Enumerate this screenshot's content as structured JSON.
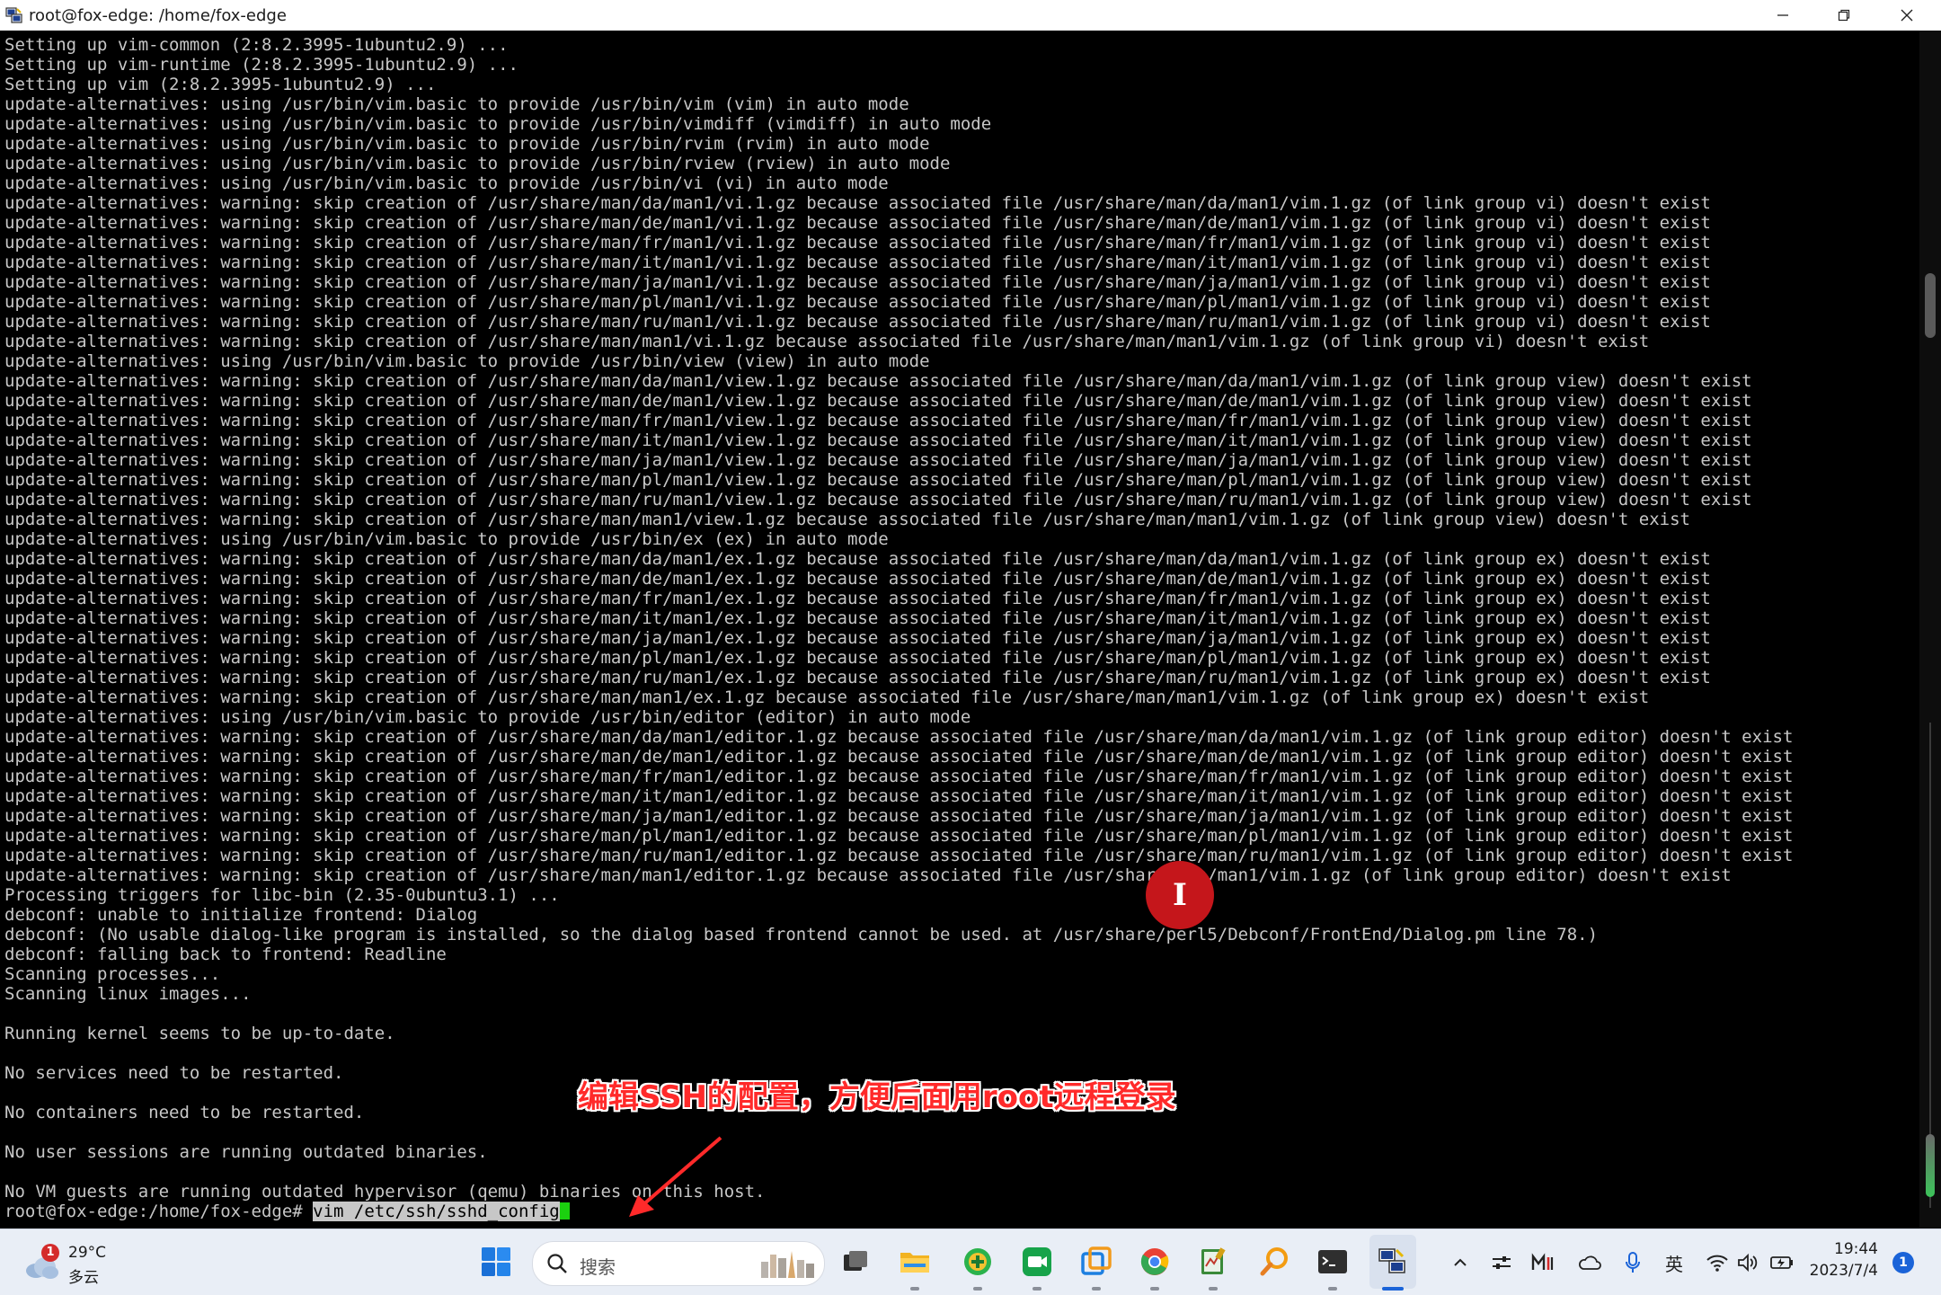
{
  "window": {
    "title": "root@fox-edge: /home/fox-edge",
    "controls": {
      "minimize": "minimize-icon",
      "maximize": "maximize-icon",
      "close": "close-icon"
    }
  },
  "terminal": {
    "lines": [
      "Setting up vim-common (2:8.2.3995-1ubuntu2.9) ...",
      "Setting up vim-runtime (2:8.2.3995-1ubuntu2.9) ...",
      "Setting up vim (2:8.2.3995-1ubuntu2.9) ...",
      "update-alternatives: using /usr/bin/vim.basic to provide /usr/bin/vim (vim) in auto mode",
      "update-alternatives: using /usr/bin/vim.basic to provide /usr/bin/vimdiff (vimdiff) in auto mode",
      "update-alternatives: using /usr/bin/vim.basic to provide /usr/bin/rvim (rvim) in auto mode",
      "update-alternatives: using /usr/bin/vim.basic to provide /usr/bin/rview (rview) in auto mode",
      "update-alternatives: using /usr/bin/vim.basic to provide /usr/bin/vi (vi) in auto mode",
      "update-alternatives: warning: skip creation of /usr/share/man/da/man1/vi.1.gz because associated file /usr/share/man/da/man1/vim.1.gz (of link group vi) doesn't exist",
      "update-alternatives: warning: skip creation of /usr/share/man/de/man1/vi.1.gz because associated file /usr/share/man/de/man1/vim.1.gz (of link group vi) doesn't exist",
      "update-alternatives: warning: skip creation of /usr/share/man/fr/man1/vi.1.gz because associated file /usr/share/man/fr/man1/vim.1.gz (of link group vi) doesn't exist",
      "update-alternatives: warning: skip creation of /usr/share/man/it/man1/vi.1.gz because associated file /usr/share/man/it/man1/vim.1.gz (of link group vi) doesn't exist",
      "update-alternatives: warning: skip creation of /usr/share/man/ja/man1/vi.1.gz because associated file /usr/share/man/ja/man1/vim.1.gz (of link group vi) doesn't exist",
      "update-alternatives: warning: skip creation of /usr/share/man/pl/man1/vi.1.gz because associated file /usr/share/man/pl/man1/vim.1.gz (of link group vi) doesn't exist",
      "update-alternatives: warning: skip creation of /usr/share/man/ru/man1/vi.1.gz because associated file /usr/share/man/ru/man1/vim.1.gz (of link group vi) doesn't exist",
      "update-alternatives: warning: skip creation of /usr/share/man/man1/vi.1.gz because associated file /usr/share/man/man1/vim.1.gz (of link group vi) doesn't exist",
      "update-alternatives: using /usr/bin/vim.basic to provide /usr/bin/view (view) in auto mode",
      "update-alternatives: warning: skip creation of /usr/share/man/da/man1/view.1.gz because associated file /usr/share/man/da/man1/vim.1.gz (of link group view) doesn't exist",
      "update-alternatives: warning: skip creation of /usr/share/man/de/man1/view.1.gz because associated file /usr/share/man/de/man1/vim.1.gz (of link group view) doesn't exist",
      "update-alternatives: warning: skip creation of /usr/share/man/fr/man1/view.1.gz because associated file /usr/share/man/fr/man1/vim.1.gz (of link group view) doesn't exist",
      "update-alternatives: warning: skip creation of /usr/share/man/it/man1/view.1.gz because associated file /usr/share/man/it/man1/vim.1.gz (of link group view) doesn't exist",
      "update-alternatives: warning: skip creation of /usr/share/man/ja/man1/view.1.gz because associated file /usr/share/man/ja/man1/vim.1.gz (of link group view) doesn't exist",
      "update-alternatives: warning: skip creation of /usr/share/man/pl/man1/view.1.gz because associated file /usr/share/man/pl/man1/vim.1.gz (of link group view) doesn't exist",
      "update-alternatives: warning: skip creation of /usr/share/man/ru/man1/view.1.gz because associated file /usr/share/man/ru/man1/vim.1.gz (of link group view) doesn't exist",
      "update-alternatives: warning: skip creation of /usr/share/man/man1/view.1.gz because associated file /usr/share/man/man1/vim.1.gz (of link group view) doesn't exist",
      "update-alternatives: using /usr/bin/vim.basic to provide /usr/bin/ex (ex) in auto mode",
      "update-alternatives: warning: skip creation of /usr/share/man/da/man1/ex.1.gz because associated file /usr/share/man/da/man1/vim.1.gz (of link group ex) doesn't exist",
      "update-alternatives: warning: skip creation of /usr/share/man/de/man1/ex.1.gz because associated file /usr/share/man/de/man1/vim.1.gz (of link group ex) doesn't exist",
      "update-alternatives: warning: skip creation of /usr/share/man/fr/man1/ex.1.gz because associated file /usr/share/man/fr/man1/vim.1.gz (of link group ex) doesn't exist",
      "update-alternatives: warning: skip creation of /usr/share/man/it/man1/ex.1.gz because associated file /usr/share/man/it/man1/vim.1.gz (of link group ex) doesn't exist",
      "update-alternatives: warning: skip creation of /usr/share/man/ja/man1/ex.1.gz because associated file /usr/share/man/ja/man1/vim.1.gz (of link group ex) doesn't exist",
      "update-alternatives: warning: skip creation of /usr/share/man/pl/man1/ex.1.gz because associated file /usr/share/man/pl/man1/vim.1.gz (of link group ex) doesn't exist",
      "update-alternatives: warning: skip creation of /usr/share/man/ru/man1/ex.1.gz because associated file /usr/share/man/ru/man1/vim.1.gz (of link group ex) doesn't exist",
      "update-alternatives: warning: skip creation of /usr/share/man/man1/ex.1.gz because associated file /usr/share/man/man1/vim.1.gz (of link group ex) doesn't exist",
      "update-alternatives: using /usr/bin/vim.basic to provide /usr/bin/editor (editor) in auto mode",
      "update-alternatives: warning: skip creation of /usr/share/man/da/man1/editor.1.gz because associated file /usr/share/man/da/man1/vim.1.gz (of link group editor) doesn't exist",
      "update-alternatives: warning: skip creation of /usr/share/man/de/man1/editor.1.gz because associated file /usr/share/man/de/man1/vim.1.gz (of link group editor) doesn't exist",
      "update-alternatives: warning: skip creation of /usr/share/man/fr/man1/editor.1.gz because associated file /usr/share/man/fr/man1/vim.1.gz (of link group editor) doesn't exist",
      "update-alternatives: warning: skip creation of /usr/share/man/it/man1/editor.1.gz because associated file /usr/share/man/it/man1/vim.1.gz (of link group editor) doesn't exist",
      "update-alternatives: warning: skip creation of /usr/share/man/ja/man1/editor.1.gz because associated file /usr/share/man/ja/man1/vim.1.gz (of link group editor) doesn't exist",
      "update-alternatives: warning: skip creation of /usr/share/man/pl/man1/editor.1.gz because associated file /usr/share/man/pl/man1/vim.1.gz (of link group editor) doesn't exist",
      "update-alternatives: warning: skip creation of /usr/share/man/ru/man1/editor.1.gz because associated file /usr/share/man/ru/man1/vim.1.gz (of link group editor) doesn't exist",
      "update-alternatives: warning: skip creation of /usr/share/man/man1/editor.1.gz because associated file /usr/share/man/man1/vim.1.gz (of link group editor) doesn't exist",
      "Processing triggers for libc-bin (2.35-0ubuntu3.1) ...",
      "debconf: unable to initialize frontend: Dialog",
      "debconf: (No usable dialog-like program is installed, so the dialog based frontend cannot be used. at /usr/share/perl5/Debconf/FrontEnd/Dialog.pm line 78.)",
      "debconf: falling back to frontend: Readline",
      "Scanning processes...",
      "Scanning linux images...",
      "",
      "Running kernel seems to be up-to-date.",
      "",
      "No services need to be restarted.",
      "",
      "No containers need to be restarted.",
      "",
      "No user sessions are running outdated binaries.",
      "",
      "No VM guests are running outdated hypervisor (qemu) binaries on this host."
    ],
    "prompt": "root@fox-edge:/home/fox-edge# ",
    "command": "vim /etc/ssh/sshd_config",
    "cursor_color": "#1bd10f"
  },
  "annotation": {
    "text": "编辑SSH的配置，方便后面用root远程登录",
    "color": "#ff2a2a"
  },
  "taskbar": {
    "weather": {
      "badge": "1",
      "temperature": "29°C",
      "condition": "多云"
    },
    "search_placeholder": "搜索",
    "apps": [
      "start-icon",
      "search-icon",
      "task-view-icon",
      "file-explorer-icon",
      "add-app-icon",
      "video-meeting-icon",
      "remote-app-icon",
      "chrome-icon",
      "notepad-icon",
      "magnifier-icon",
      "terminal-icon",
      "network-tool-icon"
    ],
    "tray": {
      "ime_label": "英"
    },
    "clock": {
      "time": "19:44",
      "date": "2023/7/4"
    },
    "notification_count": "1"
  }
}
